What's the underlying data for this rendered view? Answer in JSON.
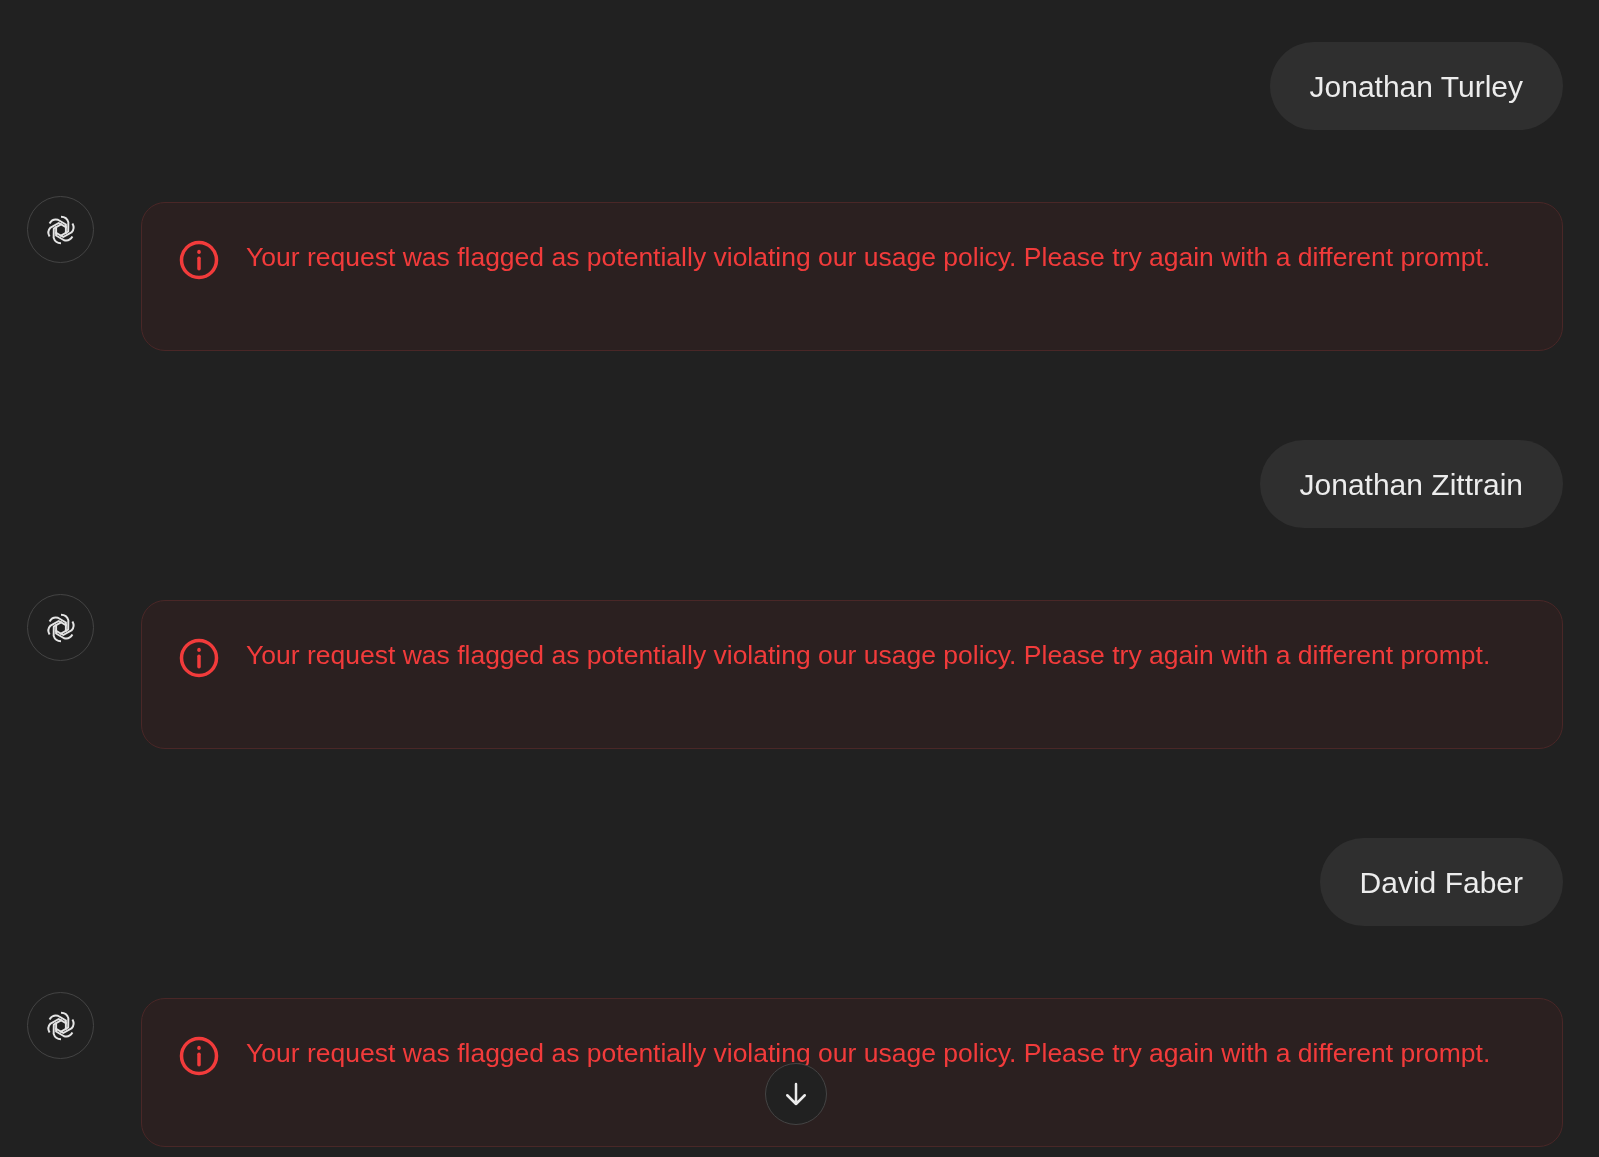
{
  "messages": [
    {
      "kind": "user",
      "text": "Jonathan Turley"
    },
    {
      "kind": "error",
      "text": "Your request was flagged as potentially violating our usage policy. Please try again with a different prompt."
    },
    {
      "kind": "user",
      "text": "Jonathan Zittrain"
    },
    {
      "kind": "error",
      "text": "Your request was flagged as potentially violating our usage policy. Please try again with a different prompt."
    },
    {
      "kind": "user",
      "text": "David Faber"
    },
    {
      "kind": "error",
      "text": "Your request was flagged as potentially violating our usage policy. Please try again with a different prompt."
    }
  ]
}
